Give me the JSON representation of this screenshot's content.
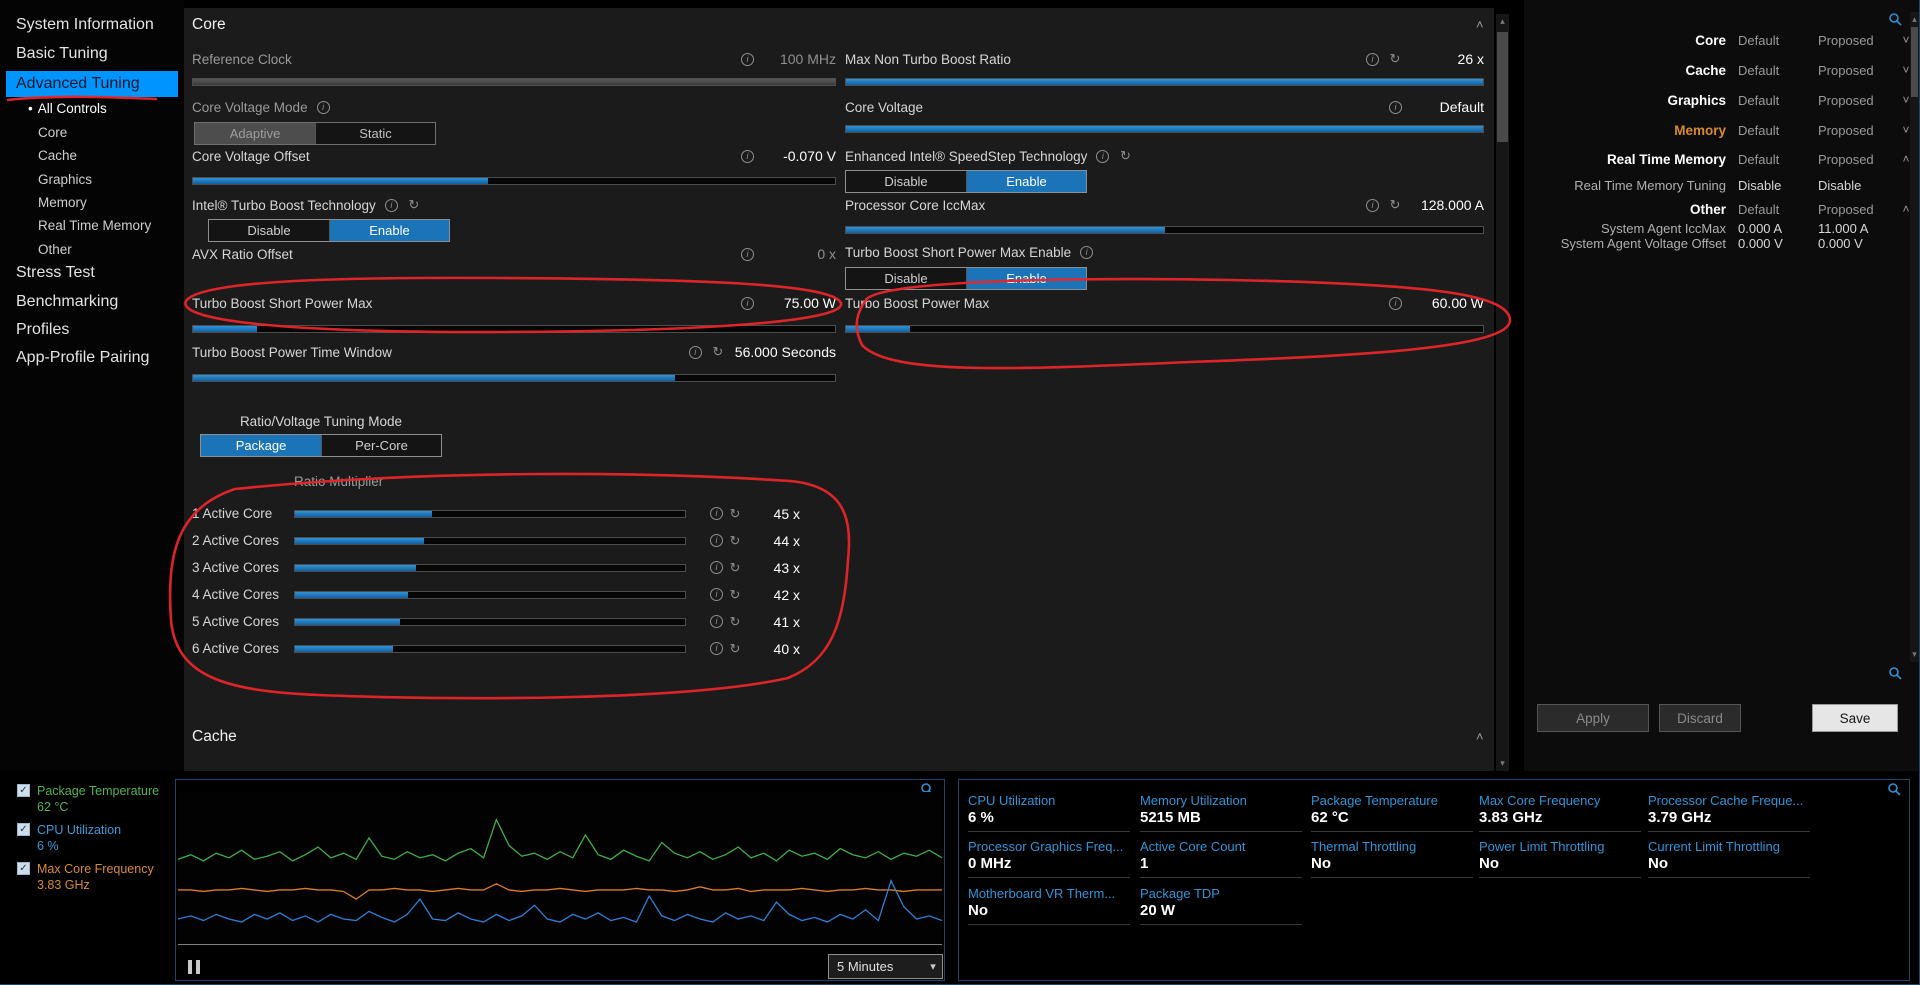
{
  "icons": {
    "info": "i",
    "reset": "↻",
    "chevron_up": "˄",
    "chevron_down": "˅",
    "tri_up": "▴",
    "tri_down": "▾",
    "dropdown": "▾",
    "check": "✓",
    "bullet": "•"
  },
  "sidebar": {
    "items": [
      {
        "label": "System Information"
      },
      {
        "label": "Basic Tuning"
      },
      {
        "label": "Advanced Tuning",
        "selected": true
      },
      {
        "label": "All Controls",
        "sub": true,
        "active": true
      },
      {
        "label": "Core",
        "sub": true
      },
      {
        "label": "Cache",
        "sub": true
      },
      {
        "label": "Graphics",
        "sub": true
      },
      {
        "label": "Memory",
        "sub": true
      },
      {
        "label": "Real Time Memory",
        "sub": true
      },
      {
        "label": "Other",
        "sub": true
      },
      {
        "label": "Stress Test"
      },
      {
        "label": "Benchmarking"
      },
      {
        "label": "Profiles"
      },
      {
        "label": "App-Profile Pairing"
      }
    ]
  },
  "core_section": {
    "title": "Core",
    "controls": {
      "reference_clock": {
        "label": "Reference Clock",
        "value": "100 MHz",
        "fill": 100
      },
      "max_non_turbo": {
        "label": "Max Non Turbo Boost Ratio",
        "value": "26 x",
        "fill": 100
      },
      "core_voltage_mode": {
        "label": "Core Voltage Mode",
        "options": [
          "Adaptive",
          "Static"
        ],
        "selected": "Adaptive"
      },
      "core_voltage": {
        "label": "Core Voltage",
        "value": "Default",
        "fill": 100
      },
      "core_voltage_offset": {
        "label": "Core Voltage Offset",
        "value": "-0.070 V",
        "fill": 46
      },
      "speedstep": {
        "label": "Enhanced Intel® SpeedStep Technology",
        "options": [
          "Disable",
          "Enable"
        ],
        "selected": "Enable"
      },
      "turbo_boost_tech": {
        "label": "Intel® Turbo Boost Technology",
        "options": [
          "Disable",
          "Enable"
        ],
        "selected": "Enable"
      },
      "core_iccmax": {
        "label": "Processor Core IccMax",
        "value": "128.000 A",
        "fill": 50
      },
      "avx_offset": {
        "label": "AVX Ratio Offset",
        "value": "0 x"
      },
      "tb_short_power_enable": {
        "label": "Turbo Boost Short Power Max Enable",
        "options": [
          "Disable",
          "Enable"
        ],
        "selected": "Enable"
      },
      "tb_short_power_max": {
        "label": "Turbo Boost Short Power Max",
        "value": "75.00 W",
        "fill": 10
      },
      "tb_power_max": {
        "label": "Turbo Boost Power Max",
        "value": "60.00 W",
        "fill": 10
      },
      "tb_power_time_window": {
        "label": "Turbo Boost Power Time Window",
        "value": "56.000 Seconds",
        "fill": 75
      }
    },
    "tuning_mode": {
      "label": "Ratio/Voltage Tuning Mode",
      "options": [
        "Package",
        "Per-Core"
      ],
      "selected": "Package"
    },
    "ratio_multiplier": {
      "label": "Ratio Multiplier",
      "rows": [
        {
          "label": "1 Active Core",
          "value": "45 x",
          "fill": 35
        },
        {
          "label": "2 Active Cores",
          "value": "44 x",
          "fill": 33
        },
        {
          "label": "3 Active Cores",
          "value": "43 x",
          "fill": 31
        },
        {
          "label": "4 Active Cores",
          "value": "42 x",
          "fill": 29
        },
        {
          "label": "5 Active Cores",
          "value": "41 x",
          "fill": 27
        },
        {
          "label": "6 Active Cores",
          "value": "40 x",
          "fill": 25
        }
      ]
    }
  },
  "cache_section": {
    "title": "Cache"
  },
  "right_panel": {
    "sections": [
      {
        "label": "Core",
        "default": "Default",
        "proposed": "Proposed"
      },
      {
        "label": "Cache",
        "default": "Default",
        "proposed": "Proposed"
      },
      {
        "label": "Graphics",
        "default": "Default",
        "proposed": "Proposed"
      },
      {
        "label": "Memory",
        "default": "Default",
        "proposed": "Proposed",
        "highlight_color": "#d98a2b"
      },
      {
        "label": "Real Time Memory",
        "default": "Default",
        "proposed": "Proposed",
        "children": [
          {
            "label": "Real Time Memory Tuning",
            "default": "Disable",
            "proposed": "Disable"
          }
        ]
      },
      {
        "label": "Other",
        "default": "Default",
        "proposed": "Proposed",
        "children": [
          {
            "label": "System Agent IccMax",
            "default": "0.000 A",
            "proposed": "11.000 A"
          },
          {
            "label": "System Agent Voltage Offset",
            "default": "0.000 V",
            "proposed": "0.000 V"
          }
        ]
      }
    ],
    "buttons": {
      "apply": "Apply",
      "discard": "Discard",
      "save": "Save"
    }
  },
  "monitor": {
    "legend": [
      {
        "label": "Package Temperature",
        "value": "62 °C",
        "color": "#52b152",
        "checked": true
      },
      {
        "label": "CPU Utilization",
        "value": "6 %",
        "color": "#3a9ad9",
        "checked": true
      },
      {
        "label": "Max Core Frequency",
        "value": "3.83 GHz",
        "color": "#d98c35",
        "checked": true
      }
    ],
    "interval": "5 Minutes",
    "stats": [
      {
        "label": "CPU Utilization",
        "value": "6 %"
      },
      {
        "label": "Memory Utilization",
        "value": "5215  MB"
      },
      {
        "label": "Package Temperature",
        "value": "62 °C"
      },
      {
        "label": "Max Core Frequency",
        "value": "3.83 GHz"
      },
      {
        "label": "Processor Cache Freque...",
        "value": "3.79 GHz"
      },
      {
        "label": "Processor Graphics Freq...",
        "value": "0 MHz"
      },
      {
        "label": "Active Core Count",
        "value": "1"
      },
      {
        "label": "Thermal Throttling",
        "value": "No"
      },
      {
        "label": "Power Limit Throttling",
        "value": "No"
      },
      {
        "label": "Current Limit Throttling",
        "value": "No"
      },
      {
        "label": "Motherboard VR Therm...",
        "value": "No"
      },
      {
        "label": "Package TDP",
        "value": "20 W"
      }
    ],
    "graph": {
      "series": [
        {
          "name": "Package Temperature",
          "color": "#3fae4a",
          "points": [
            0.44,
            0.41,
            0.45,
            0.4,
            0.43,
            0.38,
            0.44,
            0.42,
            0.39,
            0.45,
            0.41,
            0.36,
            0.43,
            0.4,
            0.44,
            0.3,
            0.42,
            0.44,
            0.39,
            0.43,
            0.41,
            0.45,
            0.4,
            0.37,
            0.43,
            0.18,
            0.35,
            0.42,
            0.4,
            0.44,
            0.39,
            0.43,
            0.28,
            0.41,
            0.44,
            0.38,
            0.42,
            0.45,
            0.33,
            0.4,
            0.43,
            0.39,
            0.44,
            0.41,
            0.36,
            0.43,
            0.4,
            0.45,
            0.38,
            0.42,
            0.4,
            0.44,
            0.37,
            0.41,
            0.43,
            0.39,
            0.44,
            0.4,
            0.42,
            0.38,
            0.43
          ]
        },
        {
          "name": "Max Core Frequency",
          "color": "#e07b28",
          "points": [
            0.64,
            0.64,
            0.65,
            0.64,
            0.64,
            0.63,
            0.64,
            0.65,
            0.64,
            0.64,
            0.63,
            0.64,
            0.64,
            0.65,
            0.7,
            0.64,
            0.64,
            0.63,
            0.64,
            0.64,
            0.65,
            0.64,
            0.63,
            0.64,
            0.64,
            0.6,
            0.64,
            0.65,
            0.64,
            0.64,
            0.63,
            0.64,
            0.65,
            0.64,
            0.64,
            0.64,
            0.63,
            0.64,
            0.64,
            0.65,
            0.64,
            0.62,
            0.64,
            0.64,
            0.63,
            0.65,
            0.64,
            0.64,
            0.64,
            0.63,
            0.64,
            0.65,
            0.64,
            0.64,
            0.63,
            0.64,
            0.64,
            0.65,
            0.64,
            0.64,
            0.64
          ]
        },
        {
          "name": "CPU Utilization",
          "color": "#2f7fd6",
          "points": [
            0.83,
            0.81,
            0.84,
            0.8,
            0.83,
            0.85,
            0.8,
            0.83,
            0.79,
            0.84,
            0.81,
            0.85,
            0.8,
            0.83,
            0.84,
            0.78,
            0.82,
            0.85,
            0.8,
            0.7,
            0.83,
            0.84,
            0.79,
            0.83,
            0.85,
            0.8,
            0.84,
            0.81,
            0.74,
            0.83,
            0.85,
            0.8,
            0.83,
            0.79,
            0.84,
            0.82,
            0.85,
            0.68,
            0.81,
            0.84,
            0.8,
            0.83,
            0.85,
            0.79,
            0.83,
            0.81,
            0.84,
            0.72,
            0.8,
            0.84,
            0.82,
            0.85,
            0.8,
            0.83,
            0.77,
            0.84,
            0.58,
            0.75,
            0.83,
            0.81,
            0.84
          ]
        }
      ]
    }
  },
  "annotations": {
    "ink_color": "#e8262a"
  }
}
